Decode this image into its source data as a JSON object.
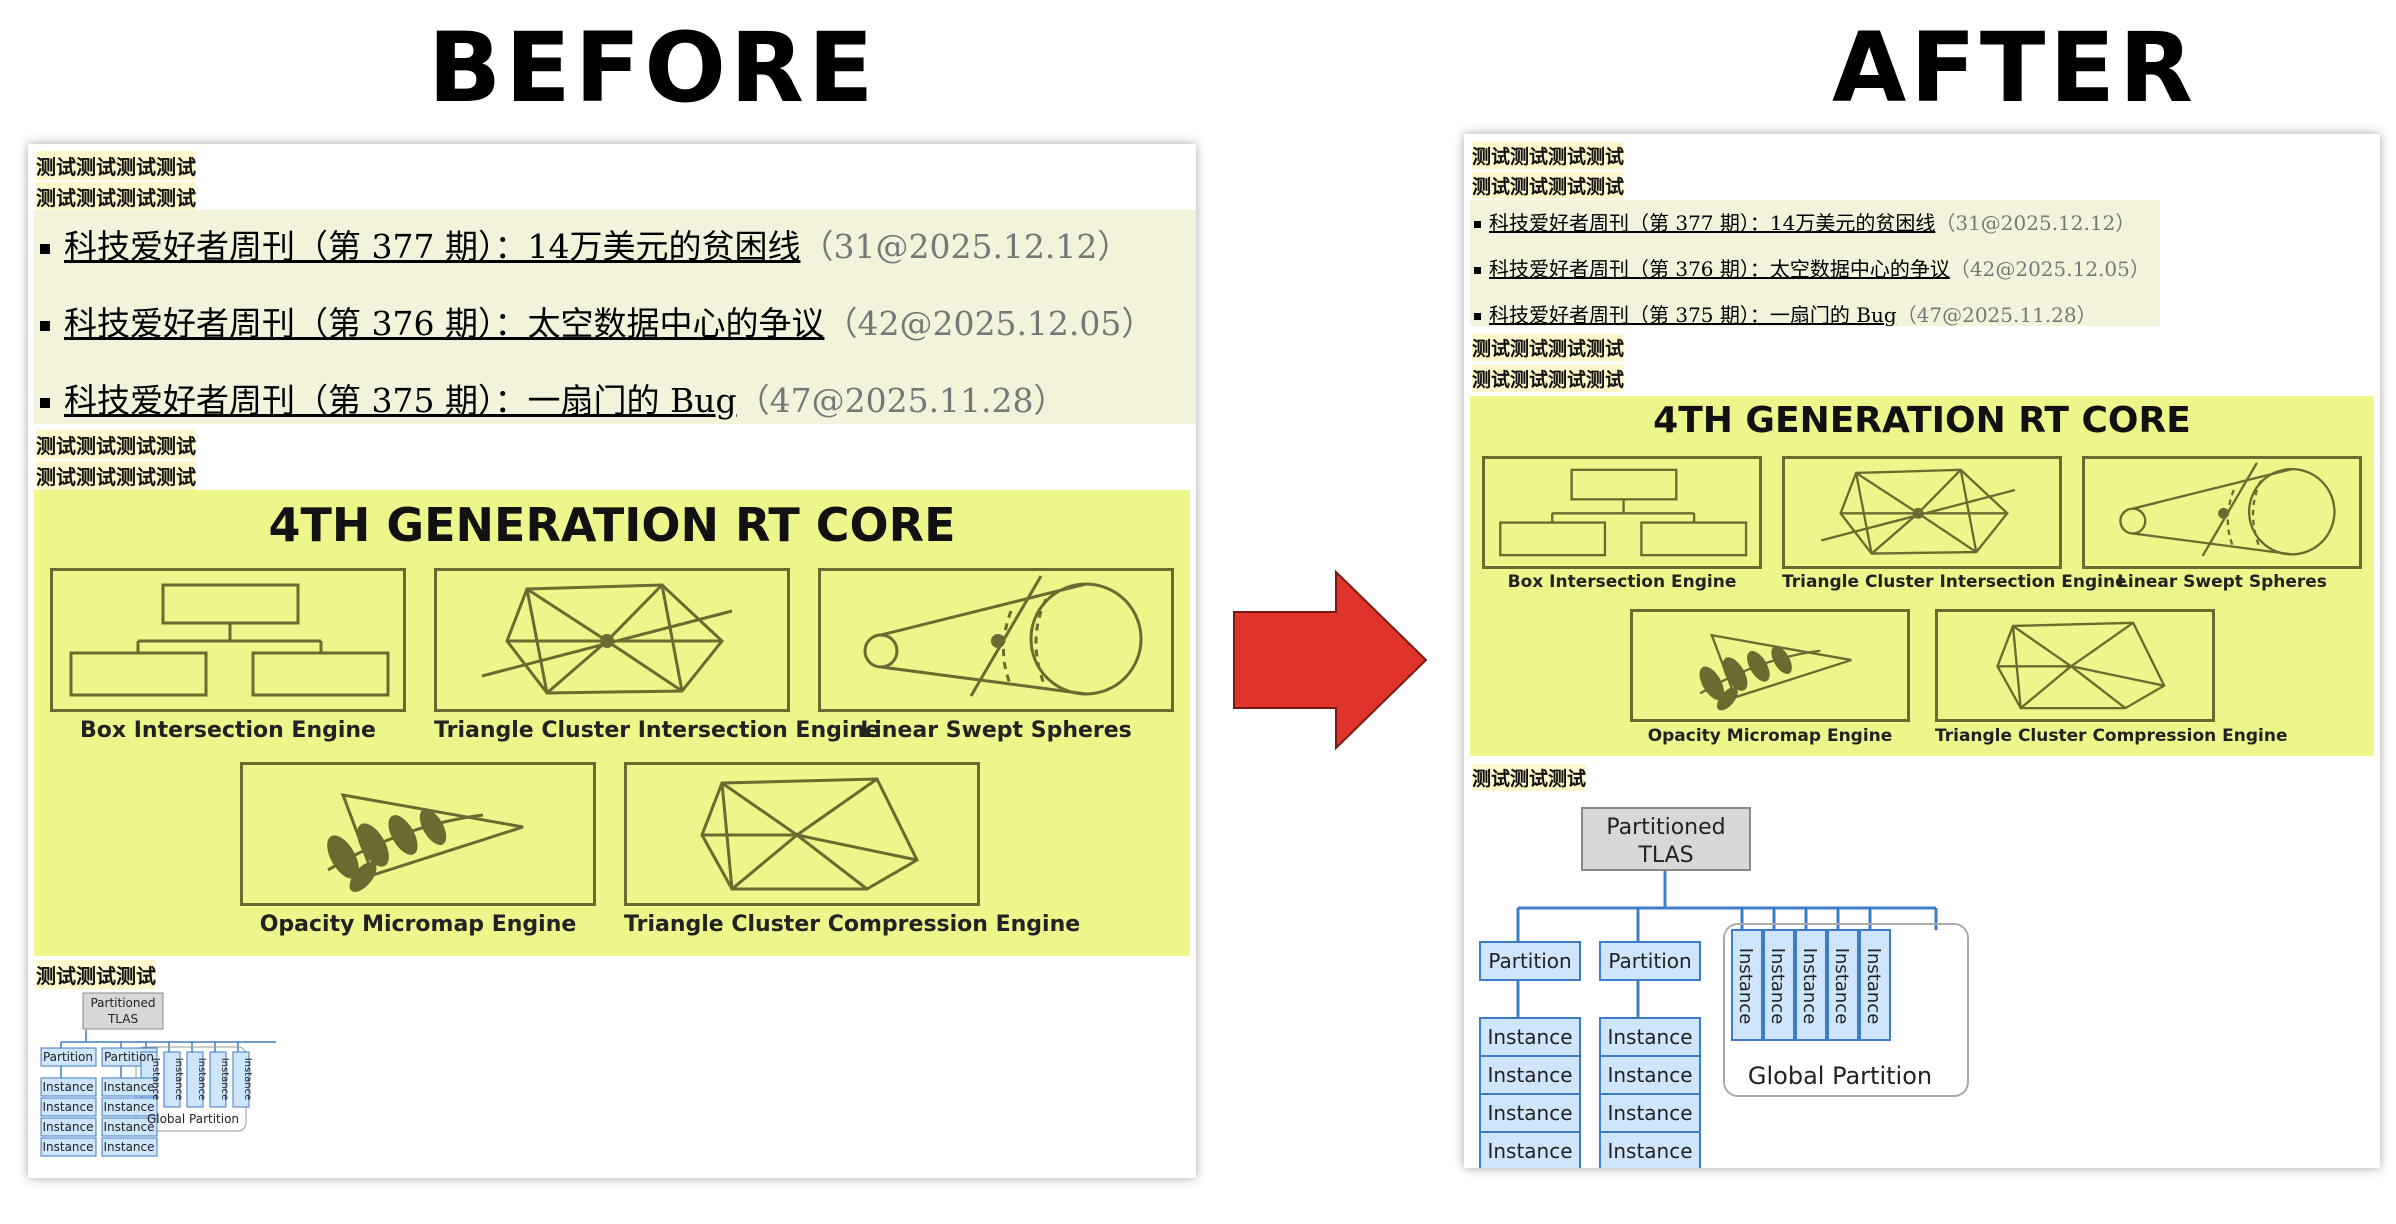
{
  "header": {
    "before_label": "BEFORE",
    "after_label": "AFTER"
  },
  "test_text": {
    "long": "测试测试测试测试",
    "short": "测试测试测试"
  },
  "news": [
    {
      "link": "科技爱好者周刊（第 377 期）：14万美元的贫困线",
      "meta": "（31@2025.12.12）"
    },
    {
      "link": "科技爱好者周刊（第 376 期）：太空数据中心的争议",
      "meta": "（42@2025.12.05）"
    },
    {
      "link": "科技爱好者周刊（第 375 期）：一扇门的 Bug",
      "meta": "（47@2025.11.28）"
    }
  ],
  "rt_core": {
    "title": "4TH GENERATION RT CORE",
    "engines": [
      "Box Intersection Engine",
      "Triangle Cluster Intersection Engine",
      "Linear Swept Spheres",
      "Opacity Micromap Engine",
      "Triangle Cluster Compression Engine"
    ]
  },
  "tlas": {
    "root_line1": "Partitioned",
    "root_line2": "TLAS",
    "partition": "Partition",
    "instance": "Instance",
    "global": "Global Partition"
  },
  "colors": {
    "highlight": "#eef58a",
    "news_bg": "#f3f3dc",
    "test_bg": "#fff7cc",
    "arrow": "#e0342a",
    "tree_line": "#3d7cc9",
    "tree_box": "#cfe5fb"
  }
}
